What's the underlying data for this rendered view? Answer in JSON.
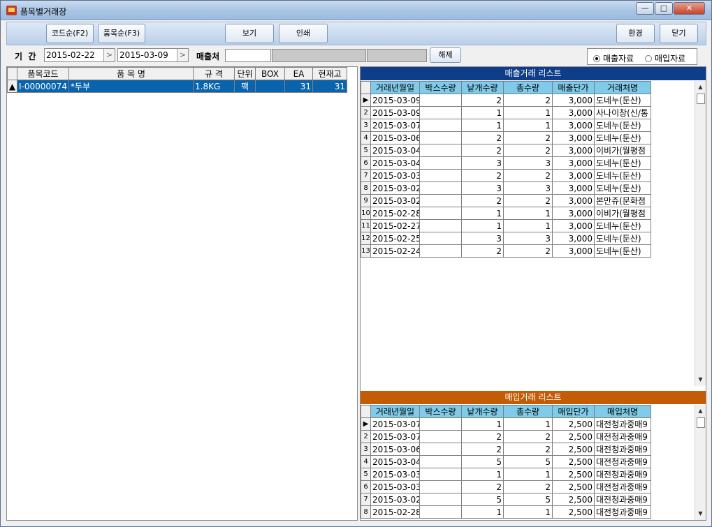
{
  "window": {
    "title": "품목별거래장",
    "minimize": "—",
    "maximize": "□",
    "close": "✕"
  },
  "toolbar": {
    "code_sort": "코드순(F2)",
    "item_sort": "품목순(F3)",
    "view": "보기",
    "print": "인쇄",
    "settings": "환경",
    "close": "닫기"
  },
  "filter": {
    "period_label": "기  간",
    "date_from": "2015-02-22",
    "date_to": "2015-03-09",
    "customer_label": "매출처",
    "customer_value": "",
    "clear_button": "해제",
    "radio_sales": "매출자료",
    "radio_purchase": "매입자료",
    "selected": "sales"
  },
  "item_table": {
    "headers": [
      "품목코드",
      "품 목 명",
      "규 격",
      "단위",
      "BOX",
      "EA",
      "현재고"
    ],
    "rows": [
      [
        "I-00000074",
        "*두부",
        "1.8KG",
        "팩",
        "",
        "31",
        "31"
      ]
    ]
  },
  "sales_list": {
    "title": "매출거래 리스트",
    "headers": [
      "거래년월일",
      "박스수량",
      "낱개수량",
      "총수량",
      "매출단가",
      "거래처명"
    ],
    "rows": [
      [
        "1",
        "2015-03-09",
        "",
        "2",
        "2",
        "3,000",
        "도네누(둔산)"
      ],
      [
        "2",
        "2015-03-09",
        "",
        "1",
        "1",
        "3,000",
        "사나이창(신/통"
      ],
      [
        "3",
        "2015-03-07",
        "",
        "1",
        "1",
        "3,000",
        "도네누(둔산)"
      ],
      [
        "4",
        "2015-03-06",
        "",
        "2",
        "2",
        "3,000",
        "도네누(둔산)"
      ],
      [
        "5",
        "2015-03-04",
        "",
        "2",
        "2",
        "3,000",
        "이비가(월평점"
      ],
      [
        "6",
        "2015-03-04",
        "",
        "3",
        "3",
        "3,000",
        "도네누(둔산)"
      ],
      [
        "7",
        "2015-03-03",
        "",
        "2",
        "2",
        "3,000",
        "도네누(둔산)"
      ],
      [
        "8",
        "2015-03-02",
        "",
        "3",
        "3",
        "3,000",
        "도네누(둔산)"
      ],
      [
        "9",
        "2015-03-02",
        "",
        "2",
        "2",
        "3,000",
        "본만쥬(문화점"
      ],
      [
        "10",
        "2015-02-28",
        "",
        "1",
        "1",
        "3,000",
        "이비가(월평점"
      ],
      [
        "11",
        "2015-02-27",
        "",
        "1",
        "1",
        "3,000",
        "도네누(둔산)"
      ],
      [
        "12",
        "2015-02-25",
        "",
        "3",
        "3",
        "3,000",
        "도네누(둔산)"
      ],
      [
        "13",
        "2015-02-24",
        "",
        "2",
        "2",
        "3,000",
        "도네누(둔산)"
      ]
    ]
  },
  "purchase_list": {
    "title": "매입거래 리스트",
    "headers": [
      "거래년월일",
      "박스수량",
      "낱개수량",
      "총수량",
      "매입단가",
      "매입처명"
    ],
    "rows": [
      [
        "1",
        "2015-03-07",
        "",
        "1",
        "1",
        "2,500",
        "대전청과중매9"
      ],
      [
        "2",
        "2015-03-07",
        "",
        "2",
        "2",
        "2,500",
        "대전청과중매9"
      ],
      [
        "3",
        "2015-03-06",
        "",
        "2",
        "2",
        "2,500",
        "대전청과중매9"
      ],
      [
        "4",
        "2015-03-04",
        "",
        "5",
        "5",
        "2,500",
        "대전청과중매9"
      ],
      [
        "5",
        "2015-03-03",
        "",
        "1",
        "1",
        "2,500",
        "대전청과중매9"
      ],
      [
        "6",
        "2015-03-03",
        "",
        "2",
        "2",
        "2,500",
        "대전청과중매9"
      ],
      [
        "7",
        "2015-03-02",
        "",
        "5",
        "5",
        "2,500",
        "대전청과중매9"
      ],
      [
        "8",
        "2015-02-28",
        "",
        "1",
        "1",
        "2,500",
        "대전청과중매9"
      ]
    ]
  }
}
